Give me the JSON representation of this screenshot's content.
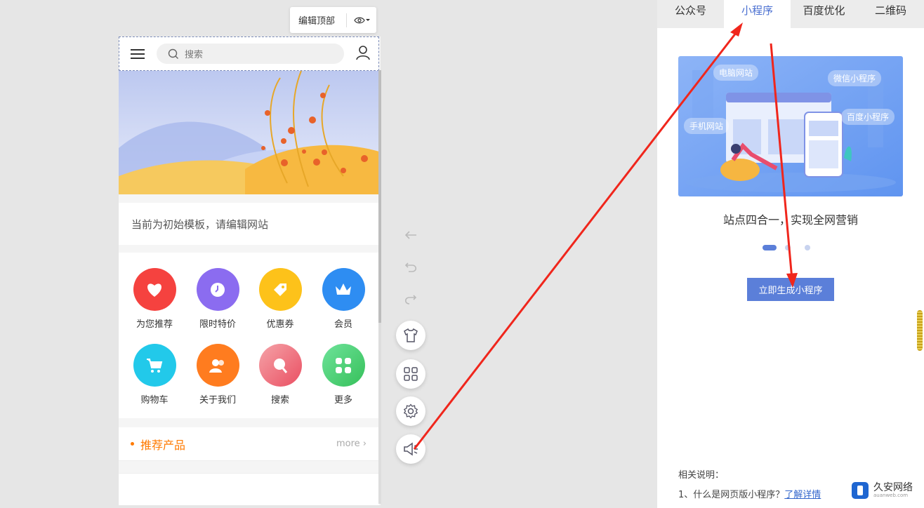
{
  "editor": {
    "edit_top_label": "编辑顶部"
  },
  "phone": {
    "search_placeholder": "搜索",
    "notice": "当前为初始模板，请编辑网站",
    "grid_items": [
      {
        "label": "为您推荐",
        "color": "#f5423f",
        "icon": "heart-icon"
      },
      {
        "label": "限时特价",
        "color": "#8b6cf0",
        "icon": "clock-icon"
      },
      {
        "label": "优惠券",
        "color": "#fdc21a",
        "icon": "tag-icon"
      },
      {
        "label": "会员",
        "color": "#2e8df2",
        "icon": "crown-icon"
      },
      {
        "label": "购物车",
        "color": "#22c9ea",
        "icon": "cart-icon"
      },
      {
        "label": "关于我们",
        "color": "#ff7c1f",
        "icon": "people-icon"
      },
      {
        "label": "搜索",
        "color": "#f0747a",
        "icon": "search-icon"
      },
      {
        "label": "更多",
        "color": "#47d16c",
        "icon": "grid-icon"
      }
    ],
    "recommend_title": "推荐产品",
    "more_label": "more"
  },
  "right_panel": {
    "tabs": [
      "公众号",
      "小程序",
      "百度优化",
      "二维码"
    ],
    "active_tab": "小程序",
    "illustration_labels": {
      "pc": "电脑网站",
      "wechat": "微信小程序",
      "mobile": "手机网站",
      "baidu": "百度小程序"
    },
    "slogan": "站点四合一，实现全网营销",
    "generate_button": "立即生成小程序",
    "notes_title": "相关说明：",
    "note1_text": "1、什么是网页版小程序？",
    "note1_link": "了解详情"
  },
  "watermark": {
    "name": "久安网络",
    "domain": "auanweb.com"
  },
  "colors": {
    "accent": "#5b7fd9",
    "orange": "#ff7a00",
    "arrow_red": "#f0261c"
  }
}
